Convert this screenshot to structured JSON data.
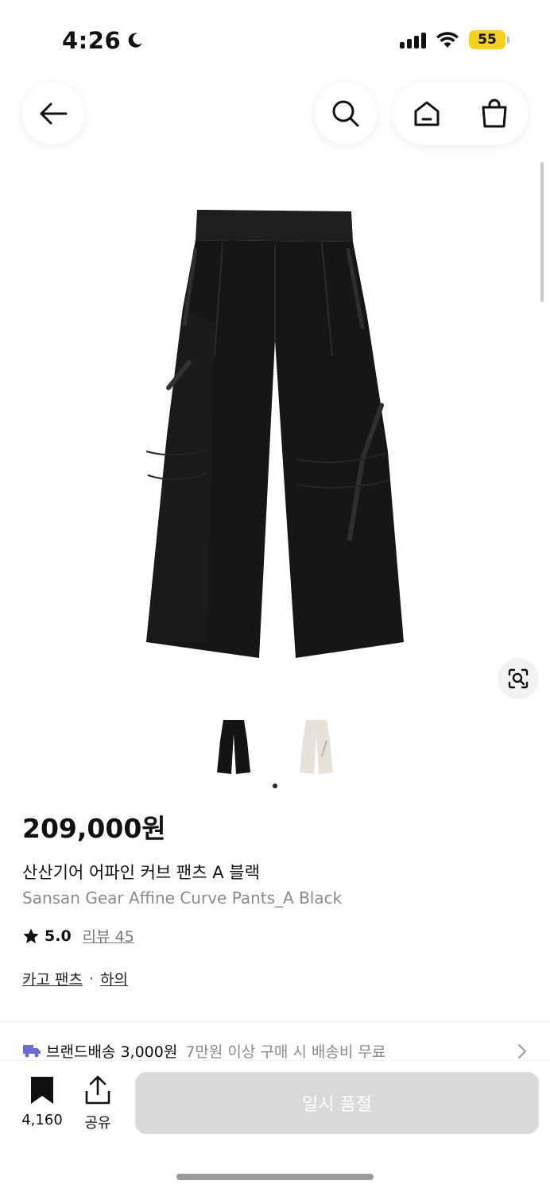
{
  "status_bar": {
    "time": "4:26",
    "battery": "55"
  },
  "colors": {
    "battery": "#f5d21a",
    "soldout_button": "#d9d9d9",
    "shipping_truck": "#6b6bd6"
  },
  "product": {
    "price": "209,000원",
    "name_ko": "산산기어 어파인 커브 팬츠 A 블랙",
    "name_en": "Sansan Gear Affine Curve Pants_A Black",
    "rating": "5.0",
    "review_label": "리뷰 45",
    "category_1": "카고 팬츠",
    "category_sep": "·",
    "category_2": "하의"
  },
  "shipping": {
    "label": "브랜드배송 3,000원",
    "note": "7만원 이상 구매 시 배송비 무료"
  },
  "bottom_bar": {
    "save_count": "4,160",
    "share_label": "공유",
    "soldout_label": "일시 품절"
  },
  "icons": [
    "back-arrow-icon",
    "search-icon",
    "home-icon",
    "shopping-bag-icon",
    "lens-search-icon",
    "star-icon",
    "truck-icon",
    "chevron-right-icon",
    "bookmark-icon",
    "share-icon"
  ]
}
